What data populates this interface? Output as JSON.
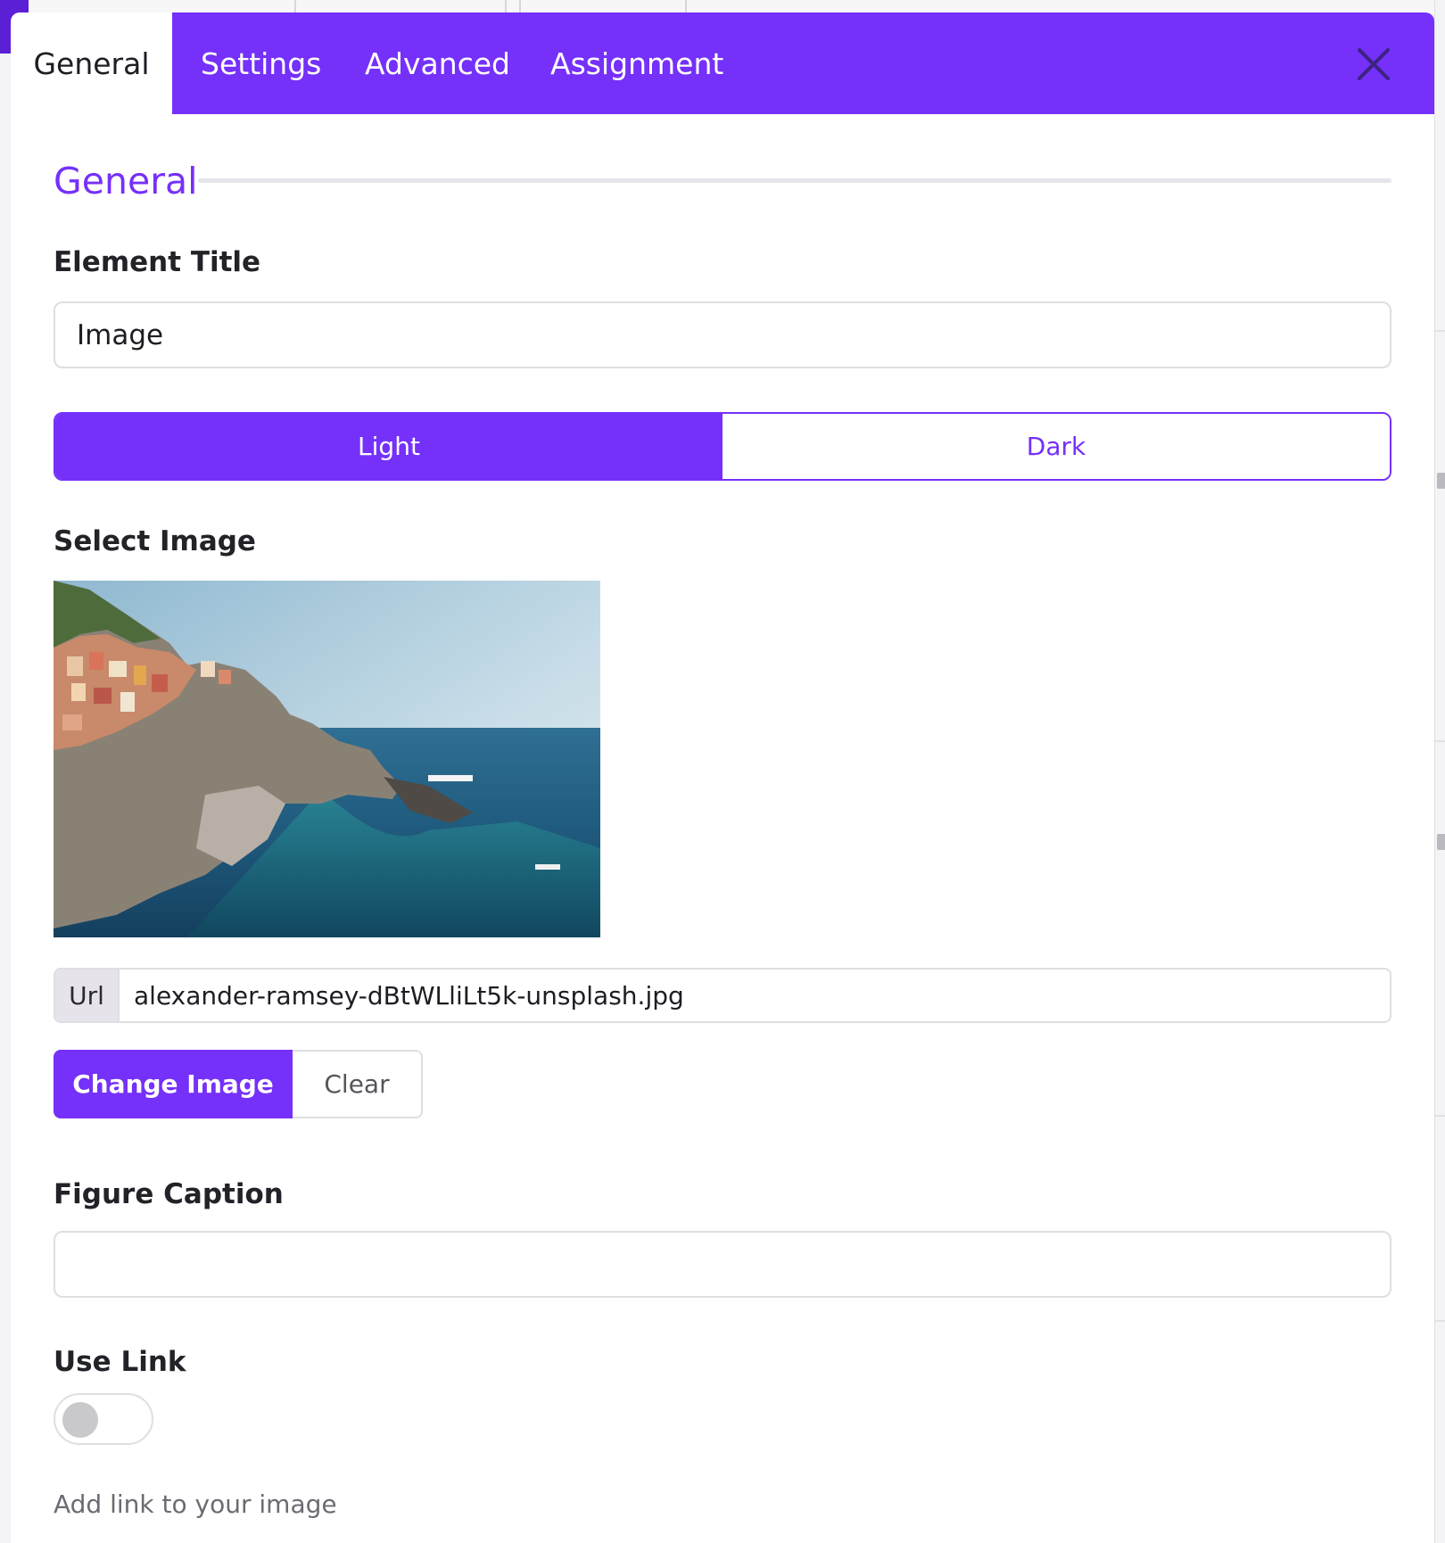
{
  "tabs": [
    {
      "label": "General",
      "active": true
    },
    {
      "label": "Settings",
      "active": false
    },
    {
      "label": "Advanced",
      "active": false
    },
    {
      "label": "Assignment",
      "active": false
    }
  ],
  "section": {
    "title": "General"
  },
  "element_title": {
    "label": "Element Title",
    "value": "Image"
  },
  "theme": {
    "options": [
      "Light",
      "Dark"
    ],
    "selected": "Light"
  },
  "select_image": {
    "label": "Select Image",
    "url_addon": "Url",
    "url_value": "alexander-ramsey-dBtWLliLt5k-unsplash.jpg",
    "change_label": "Change Image",
    "clear_label": "Clear"
  },
  "figure_caption": {
    "label": "Figure Caption",
    "value": ""
  },
  "use_link": {
    "label": "Use Link",
    "enabled": false,
    "help": "Add link to your image"
  },
  "colors": {
    "accent": "#7530fa",
    "text": "#222228",
    "muted": "#6b6b73",
    "border": "#dedee3"
  },
  "icons": {
    "close": "close-icon",
    "preview": "coastal-village-photo"
  }
}
